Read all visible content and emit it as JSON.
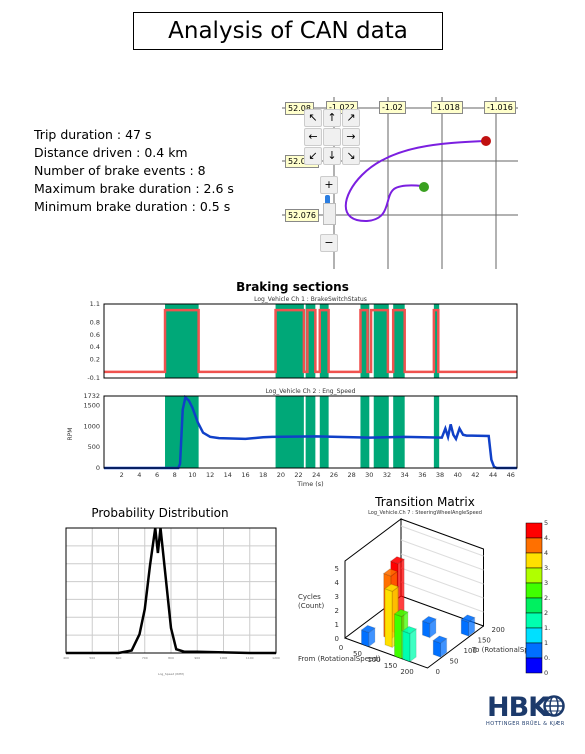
{
  "title": "Analysis of CAN data",
  "stats": [
    "Trip duration : 47 s",
    "Distance driven : 0.4 km",
    "Number of brake events : 8",
    "Maximum brake duration : 2.6 s",
    "Minimum brake duration : 0.5 s"
  ],
  "map": {
    "lat_labels": [
      "52.08",
      "52.078",
      "52.076"
    ],
    "lon_labels": [
      "-1.022",
      "-1.02",
      "-1.018",
      "-1.016"
    ],
    "zoom_in": "+",
    "zoom_out": "−",
    "arrows": [
      "↖",
      "↑",
      "↗",
      "←",
      "",
      "→",
      "↙",
      "↓",
      "↘"
    ],
    "route_color": "#7b1fe0",
    "start_color": "#3aa020",
    "end_color": "#c01010"
  },
  "chart_data": [
    {
      "type": "line",
      "title": "Braking sections",
      "subtitle": "Log_Vehicle  Ch 1 : BrakeSwitchStatus",
      "ylim": [
        -0.1,
        1.1
      ],
      "yticks": [
        "1.1",
        "0.8",
        "0.6",
        "0.4",
        "0.2",
        "-0.1"
      ],
      "xlim": [
        0,
        46.7
      ],
      "color": "#f0524f",
      "highlight_color": "#00a878",
      "braking_sections": [
        [
          6.9,
          10.7
        ],
        [
          19.4,
          22.6
        ],
        [
          22.8,
          23.9
        ],
        [
          24.4,
          25.4
        ],
        [
          29.0,
          30.0
        ],
        [
          30.5,
          32.2
        ],
        [
          32.7,
          34.0
        ],
        [
          37.3,
          37.9
        ]
      ],
      "x": [
        0,
        6.9,
        6.9,
        10.7,
        10.7,
        19.4,
        19.4,
        22.6,
        22.6,
        23.0,
        23.0,
        23.9,
        23.9,
        24.4,
        24.4,
        25.4,
        25.4,
        29.0,
        29.0,
        29.8,
        29.8,
        30.2,
        30.2,
        32.1,
        32.1,
        32.7,
        32.7,
        34.0,
        34.0,
        37.3,
        37.3,
        37.8,
        37.8,
        46.7
      ],
      "y": [
        0,
        0,
        1,
        1,
        0,
        0,
        1,
        1,
        0,
        0,
        1,
        1,
        0,
        0,
        1,
        1,
        0,
        0,
        1,
        1,
        0,
        0,
        1,
        1,
        0,
        0,
        1,
        1,
        0,
        0,
        1,
        1,
        0,
        0
      ]
    },
    {
      "type": "line",
      "subtitle": "Log_Vehicle  Ch 2 : Eng_Speed",
      "ylabel": "RPM",
      "xlabel": "Time (s)",
      "ylim": [
        0,
        1732
      ],
      "yticks": [
        "1732",
        "1500",
        "1000",
        "500",
        "0"
      ],
      "xticks": [
        "2",
        "4",
        "6",
        "8",
        "10",
        "12",
        "14",
        "16",
        "18",
        "20",
        "22",
        "24",
        "26",
        "28",
        "30",
        "32",
        "34",
        "36",
        "38",
        "40",
        "42",
        "44",
        "46"
      ],
      "xlim": [
        0,
        46.7
      ],
      "color": "#1040c8",
      "x": [
        0,
        8.4,
        8.6,
        8.9,
        9.2,
        9.6,
        10.0,
        10.6,
        11.2,
        12,
        13,
        16,
        18,
        19,
        24,
        30,
        34,
        38.2,
        38.6,
        38.9,
        39.2,
        39.5,
        39.8,
        40.2,
        40.6,
        41,
        41.6,
        43.5,
        43.8,
        44.1,
        44.4,
        46.7
      ],
      "y": [
        0,
        0,
        100,
        1400,
        1700,
        1620,
        1450,
        1100,
        850,
        750,
        720,
        700,
        740,
        750,
        760,
        730,
        750,
        730,
        950,
        750,
        1050,
        800,
        700,
        950,
        800,
        780,
        780,
        770,
        200,
        30,
        0,
        0
      ]
    },
    {
      "type": "line",
      "title": "Probability Distribution",
      "xlabel": "Log_Speed (RPM)",
      "xlim": [
        400,
        1200
      ],
      "xticks": [
        "400",
        "500",
        "600",
        "700",
        "800",
        "900",
        "1000",
        "1100",
        "1200"
      ],
      "color": "#000000",
      "x": [
        400,
        600,
        650,
        680,
        700,
        720,
        740,
        750,
        760,
        780,
        800,
        820,
        850,
        900,
        1000,
        1100,
        1200
      ],
      "y": [
        0,
        0,
        0.02,
        0.15,
        0.35,
        0.7,
        1.0,
        0.8,
        1.0,
        0.6,
        0.2,
        0.03,
        0.01,
        0.01,
        0.005,
        0,
        0
      ]
    },
    {
      "type": "bar3d",
      "title": "Transition Matrix",
      "subtitle": "Log_Vehicle.Ch 7 : SteeringWheelAngleSpeed",
      "zlabel": "Cycles (Count)",
      "xlabel": "From (RotationalSpeed)",
      "ylabel": "To (RotationalSp",
      "zticks": [
        "0",
        "1",
        "2",
        "3",
        "4",
        "5"
      ],
      "xticks": [
        "0",
        "50",
        "100",
        "150",
        "200"
      ],
      "yticks": [
        "0",
        "50",
        "100",
        "150",
        "200"
      ],
      "colorbar_ticks": [
        "5",
        "4.5",
        "4",
        "3.5",
        "3",
        "2.5",
        "2",
        "1.5",
        "1",
        "0.5",
        "0"
      ],
      "colorbar_colors": [
        "#ff0000",
        "#ff7000",
        "#ffe000",
        "#b0ff00",
        "#40ff00",
        "#00f060",
        "#00ffb0",
        "#00e0ff",
        "#0070ff",
        "#0000ff"
      ],
      "bars": [
        {
          "from": 50,
          "to": 0,
          "count": 1
        },
        {
          "from": 75,
          "to": 50,
          "count": 4.5
        },
        {
          "from": 75,
          "to": 75,
          "count": 5
        },
        {
          "from": 100,
          "to": 25,
          "count": 4
        },
        {
          "from": 150,
          "to": 0,
          "count": 3
        },
        {
          "from": 175,
          "to": 0,
          "count": 2
        },
        {
          "from": 150,
          "to": 100,
          "count": 1
        },
        {
          "from": 225,
          "to": 50,
          "count": 1
        },
        {
          "from": 225,
          "to": 150,
          "count": 1
        }
      ]
    }
  ],
  "logo": {
    "text": "HBK",
    "tagline": "HOTTINGER BRÜEL & KJÆR"
  }
}
